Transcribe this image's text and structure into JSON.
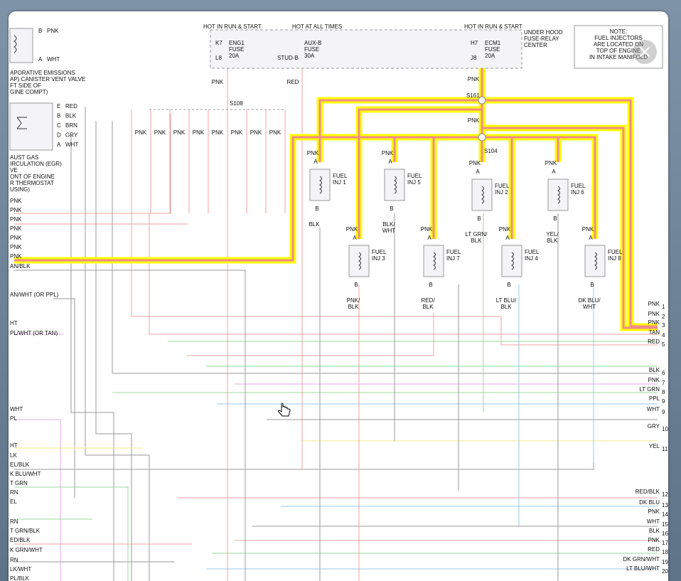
{
  "header": {
    "hot_run_start_1": "HOT IN RUN & START",
    "hot_all_times": "HOT AT ALL TIMES",
    "hot_run_start_2": "HOT IN RUN & START",
    "fuse_center": [
      "UNDER HOOD",
      "FUSE-RELAY",
      "CENTER"
    ]
  },
  "fuses": [
    {
      "pin_top": "K7",
      "pin_bot": "L8",
      "name": [
        "ENG1",
        "FUSE",
        "20A"
      ]
    },
    {
      "pin_top": "",
      "pin_bot": "STUD-B",
      "name": [
        "AUX-B",
        "FUSE",
        "30A"
      ]
    },
    {
      "pin_top": "H7",
      "pin_bot": "J8",
      "name": [
        "ECM1",
        "FUSE",
        "20A"
      ]
    }
  ],
  "note": [
    "NOTE:",
    "FUEL INJECTORS",
    "ARE LOCATED ON",
    "TOP OF ENGINE",
    "IN INTAKE MANIFOLD"
  ],
  "left_components": {
    "evap": [
      "APORATIVE EMISSIONS",
      "AP) CANISTER VENT VALVE",
      "FT SIDE OF",
      "GINE COMPT)"
    ],
    "evap_pins": [
      {
        "pin": "B",
        "color": "PNK"
      },
      {
        "pin": "A",
        "color": "WHT"
      }
    ],
    "egr": [
      "AUST GAS",
      "IRCULATION (EGR)",
      "VE",
      "ONT OF ENGINE",
      "R THERMOSTAT",
      "USING)"
    ],
    "egr_pins": [
      {
        "pin": "E",
        "color": "RED"
      },
      {
        "pin": "B",
        "color": "BLK"
      },
      {
        "pin": "C",
        "color": "BRN"
      },
      {
        "pin": "D",
        "color": "GRY"
      },
      {
        "pin": "A",
        "color": "WHT"
      }
    ]
  },
  "left_wires": [
    "PNK",
    "PNK",
    "PNK",
    "PNK",
    "PNK",
    "PNK",
    "PNK",
    "AN/BLK",
    "AN/WHT (OR PPL)",
    "HT",
    "PL/WHT (OR TAN)",
    "WHT",
    "PL",
    "HT",
    "LK",
    "EL/BLK",
    "K BLU/WHT",
    "T GRN",
    "RN",
    "EL",
    "RN",
    "T GRN/BLK",
    "ED/BLK",
    "K GRN/WHT",
    "RN",
    "LK/WHT",
    "PL/BLK"
  ],
  "splices": {
    "s108": "S108",
    "s161": "S161",
    "s104": "S104"
  },
  "pnk_row": [
    "PNK",
    "PNK",
    "PNK",
    "PNK",
    "PNK",
    "PNK",
    "PNK",
    "PNK"
  ],
  "misc": {
    "pnk": "PNK",
    "red": "RED",
    "a": "A",
    "b": "B"
  },
  "injectors": [
    {
      "name": [
        "FUEL",
        "INJ 1"
      ],
      "in": "PNK",
      "out": [
        "BLK"
      ]
    },
    {
      "name": [
        "FUEL",
        "INJ 5"
      ],
      "in": "PNK",
      "out": [
        "BLK/",
        "WHT"
      ]
    },
    {
      "name": [
        "FUEL",
        "INJ 2"
      ],
      "in": "PNK",
      "out": [
        "LT GRN/",
        "BLK"
      ]
    },
    {
      "name": [
        "FUEL",
        "INJ 6"
      ],
      "in": "PNK",
      "out": [
        "YEL/",
        "BLK"
      ]
    },
    {
      "name": [
        "FUEL",
        "INJ 3"
      ],
      "in": "PNK",
      "out": [
        "PNK/",
        "BLK"
      ]
    },
    {
      "name": [
        "FUEL",
        "INJ 7"
      ],
      "in": "PNK",
      "out": [
        "RED/",
        "BLK"
      ]
    },
    {
      "name": [
        "FUEL",
        "INJ 4"
      ],
      "in": "PNK",
      "out": [
        "LT BLU/",
        "BLK"
      ]
    },
    {
      "name": [
        "FUEL",
        "INJ 8"
      ],
      "in": "PNK",
      "out": [
        "DK BLU/",
        "WHT"
      ]
    }
  ],
  "right_connector": [
    {
      "color": "PNK",
      "pin": "1"
    },
    {
      "color": "PNK",
      "pin": "2"
    },
    {
      "color": "PNK",
      "pin": "3"
    },
    {
      "color": "TAN",
      "pin": "4"
    },
    {
      "color": "RED",
      "pin": "5"
    },
    {
      "color": "BLK",
      "pin": "6"
    },
    {
      "color": "PNK",
      "pin": "7"
    },
    {
      "color": "LT GRN",
      "pin": "8"
    },
    {
      "color": "PPL",
      "pin": "9"
    },
    {
      "color": "WHT",
      "pin": "9"
    },
    {
      "color": "GRY",
      "pin": "10"
    },
    {
      "color": "YEL",
      "pin": "11"
    },
    {
      "color": "RED/BLK",
      "pin": "12"
    },
    {
      "color": "DK BLU",
      "pin": "13"
    },
    {
      "color": "PNK",
      "pin": "14"
    },
    {
      "color": "WHT",
      "pin": "15"
    },
    {
      "color": "BLK",
      "pin": "16"
    },
    {
      "color": "PNK",
      "pin": "17"
    },
    {
      "color": "RED",
      "pin": "18"
    },
    {
      "color": "DK GRN/WHT",
      "pin": "19"
    },
    {
      "color": "LT BLU/WHT",
      "pin": "20"
    }
  ],
  "colors": {
    "highlight_outer": "#ffff00",
    "highlight_inner": "#f28b8b",
    "wire_pink": "#f0a0a0",
    "wire_gray": "#9a9a9a",
    "wire_green": "#9ad89a",
    "wire_blue": "#9ac8e8",
    "wire_violet": "#e0a8e8",
    "wire_yellow": "#eeee88"
  },
  "close_icon": "×"
}
